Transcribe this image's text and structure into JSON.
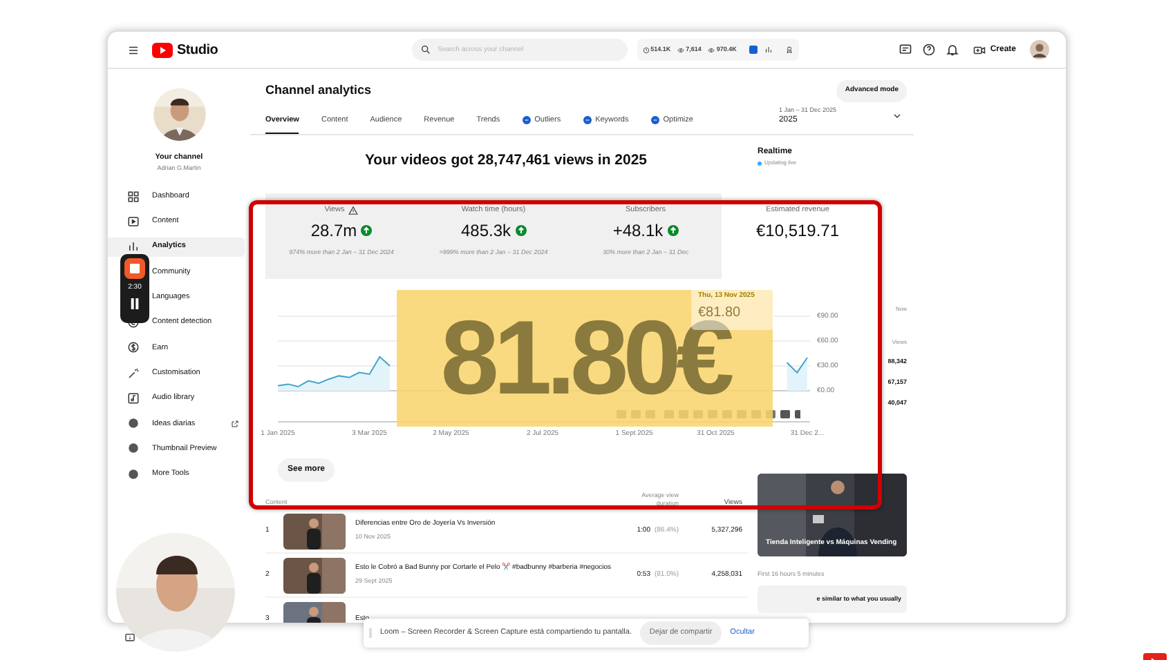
{
  "topbar": {
    "logo": "Studio",
    "search": {
      "placeholder": "Search across your channel"
    },
    "stats": [
      "514.1K",
      "7,614",
      "970.4K"
    ],
    "create": "Create"
  },
  "sidebar": {
    "channel_title": "Your channel",
    "channel_name": "Adrian G.Martin",
    "items": [
      {
        "label": "Dashboard",
        "selected": false
      },
      {
        "label": "Content",
        "selected": false
      },
      {
        "label": "Analytics",
        "selected": true
      },
      {
        "label": "Community",
        "selected": false
      },
      {
        "label": "Languages",
        "selected": false
      },
      {
        "label": "Content detection",
        "selected": false
      },
      {
        "label": "Earn",
        "selected": false
      },
      {
        "label": "Customisation",
        "selected": false
      },
      {
        "label": "Audio library",
        "selected": false
      },
      {
        "label": "Ideas diarias",
        "selected": false,
        "external": true
      },
      {
        "label": "Thumbnail Preview",
        "selected": false
      },
      {
        "label": "More Tools",
        "selected": false
      }
    ]
  },
  "header": {
    "title": "Channel analytics",
    "advanced_button": "Advanced mode",
    "date_range": "1 Jan – 31 Dec 2025",
    "date_value": "2025"
  },
  "tabs": [
    {
      "label": "Overview",
      "selected": true
    },
    {
      "label": "Content",
      "selected": false
    },
    {
      "label": "Audience",
      "selected": false
    },
    {
      "label": "Revenue",
      "selected": false
    },
    {
      "label": "Trends",
      "selected": false
    },
    {
      "label": "Outliers",
      "selected": false,
      "kind": "extension"
    },
    {
      "label": "Keywords",
      "selected": false,
      "kind": "extension"
    },
    {
      "label": "Optimize",
      "selected": false,
      "kind": "extension"
    }
  ],
  "headline": "Your videos got 28,747,461 views in 2025",
  "metrics": [
    {
      "label": "Views",
      "value": "28.7m",
      "comparison": "974% more than 2 Jan – 31 Dec 2024",
      "warning": true,
      "trend_up": true,
      "selected": false
    },
    {
      "label": "Watch time (hours)",
      "value": "485.3k",
      "comparison": ">999% more than 2 Jan – 31 Dec 2024",
      "warning": false,
      "trend_up": true,
      "selected": false
    },
    {
      "label": "Subscribers",
      "value": "+48.1k",
      "comparison": "30% more than 2 Jan – 31 Dec",
      "warning": false,
      "trend_up": true,
      "selected": false
    },
    {
      "label": "Estimated revenue",
      "value": "€10,519.71",
      "warning": false,
      "trend_up": false,
      "selected": true
    }
  ],
  "revenue_chart": {
    "chart_data": {
      "type": "area",
      "ylim": [
        0,
        90
      ],
      "yticks": [
        {
          "value": 90,
          "label": "€90.00"
        },
        {
          "value": 60,
          "label": "€60.00"
        },
        {
          "value": 30,
          "label": "€30.00"
        },
        {
          "value": 0,
          "label": "€0.00"
        }
      ],
      "categories": [
        "1 Jan 2025",
        null,
        null,
        null,
        null,
        null,
        null,
        null,
        null,
        "3 Mar 2025",
        null,
        null,
        null,
        null,
        null,
        null,
        null,
        "2 May 2025",
        null,
        null,
        null,
        null,
        null,
        null,
        null,
        null,
        "2 Jul 2025",
        null,
        null,
        null,
        null,
        null,
        null,
        null,
        null,
        "1 Sept 2025",
        null,
        null,
        null,
        null,
        null,
        null,
        null,
        "31 Oct 2025",
        null,
        null,
        null,
        null,
        null,
        null,
        null,
        null,
        "31 Dec 2..."
      ],
      "series": [
        {
          "color": "#3ea4c9",
          "values": [
            6,
            8,
            5,
            12,
            9,
            14,
            18,
            16,
            22,
            20,
            41,
            30,
            null,
            null,
            null,
            null,
            null,
            null,
            null,
            null,
            null,
            null,
            null,
            null,
            null,
            null,
            null,
            null,
            null,
            null,
            null,
            null,
            null,
            null,
            null,
            null,
            null,
            null,
            null,
            null,
            null,
            null,
            null,
            null,
            null,
            null,
            null,
            null,
            null,
            null,
            34,
            22,
            40
          ]
        }
      ]
    },
    "tooltip": {
      "date": "Thu, 13 Nov 2025",
      "value": "€81.80"
    }
  },
  "see_more": "See more",
  "overlay_amount": "81.80€",
  "top_content": {
    "columns": [
      "Content",
      "Average view duration",
      "Views"
    ],
    "rows": [
      {
        "rank": "1",
        "title": "Diferencias entre Oro de Joyería Vs Inversión",
        "date": "10 Nov 2025",
        "duration": "1:00",
        "percent": "(86.4%)",
        "views": "5,327,296"
      },
      {
        "rank": "2",
        "title": "Esto le Cobró a Bad Bunny por Cortarle el Pelo ✂️ #badbunny #barberia #negocios",
        "date": "29 Sept 2025",
        "duration": "0:53",
        "percent": "(81.0%)",
        "views": "4,258,031"
      },
      {
        "rank": "3",
        "title": "Esto"
      }
    ]
  },
  "realtime": {
    "title": "Realtime",
    "status": "Updating live",
    "now": "Now",
    "views_label": "Views",
    "values": [
      "88,342",
      "67,157",
      "40,047"
    ],
    "video_title": "Tienda Inteligente vs Máquinas Vending",
    "video_caption": "First 16 hours 5 minutes",
    "suggestion": "e similar to what you usually"
  },
  "recorder": {
    "timer": "2:30"
  },
  "share_bar": {
    "message": "Loom – Screen Recorder & Screen Capture está compartiendo tu pantalla.",
    "stop_button": "Dejar de compartir",
    "hide_link": "Ocultar"
  }
}
